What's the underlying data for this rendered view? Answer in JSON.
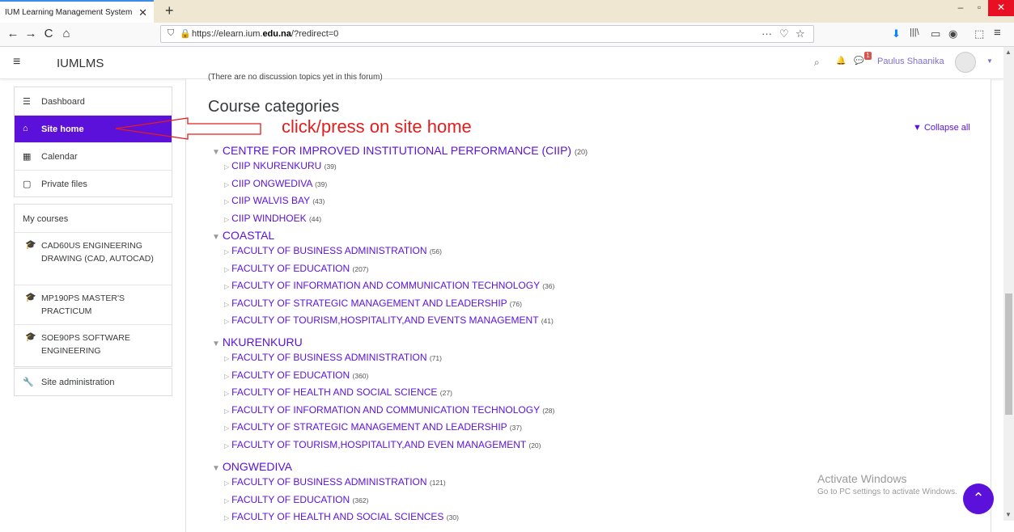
{
  "browser": {
    "tab_title": "IUM Learning Management System",
    "tab_close": "✕",
    "new_tab": "+",
    "url_prefix": "https://elearn.ium.",
    "url_domain": "edu.na",
    "url_suffix": "/?redirect=0",
    "back": "←",
    "forward": "→",
    "reload": "C",
    "home": "⌂",
    "more": "···",
    "pocket": "♡",
    "bookmark": "☆",
    "download": "⬇",
    "library": "|||\\",
    "sidebar": "▭",
    "account": "◉",
    "menu": "≡",
    "extensions": "⬚",
    "win_min": "–",
    "win_max": "▫",
    "win_close": "✕"
  },
  "header": {
    "menu_icon": "≡",
    "site_name": "IUMLMS",
    "search": "⌕",
    "bell": "🔔",
    "messages": "💬",
    "notif_count": "1",
    "user_name": "Paulus Shaanika",
    "caret": "▼"
  },
  "drawer": {
    "nav": [
      {
        "icon": "☰",
        "label": "Dashboard"
      },
      {
        "icon": "⌂",
        "label": "Site home"
      },
      {
        "icon": "▦",
        "label": "Calendar"
      },
      {
        "icon": "▢",
        "label": "Private files"
      }
    ],
    "my_courses_label": "My courses",
    "courses": [
      {
        "icon": "🎓",
        "label": "CAD60US ENGINEERING DRAWING (CAD, AUTOCAD)"
      },
      {
        "icon": "🎓",
        "label": "MP190PS MASTER'S PRACTICUM"
      },
      {
        "icon": "🎓",
        "label": "SOE90PS SOFTWARE ENGINEERING"
      }
    ],
    "admin": {
      "icon": "🔧",
      "label": "Site administration"
    }
  },
  "main": {
    "forum_note": "(There are no discussion topics yet in this forum)",
    "heading": "Course categories",
    "collapse_all": "▼ Collapse all",
    "annotation": "click/press on site home",
    "categories": [
      {
        "name": "CENTRE FOR IMPROVED INSTITUTIONAL PERFORMANCE (CIIP)",
        "count": "(20)",
        "children": [
          {
            "name": "CIIP NKURENKURU",
            "count": "(39)"
          },
          {
            "name": "CIIP ONGWEDIVA",
            "count": "(39)"
          },
          {
            "name": "CIIP WALVIS BAY",
            "count": "(43)"
          },
          {
            "name": "CIIP WINDHOEK",
            "count": "(44)"
          }
        ]
      },
      {
        "name": "COASTAL",
        "count": "",
        "children": [
          {
            "name": "FACULTY OF BUSINESS ADMINISTRATION",
            "count": "(56)"
          },
          {
            "name": "FACULTY OF EDUCATION",
            "count": "(207)"
          },
          {
            "name": "FACULTY OF INFORMATION AND COMMUNICATION TECHNOLOGY",
            "count": "(36)"
          },
          {
            "name": "FACULTY OF STRATEGIC MANAGEMENT AND LEADERSHIP",
            "count": "(76)"
          },
          {
            "name": "FACULTY OF TOURISM,HOSPITALITY,AND EVENTS MANAGEMENT",
            "count": "(41)"
          }
        ]
      },
      {
        "name": "NKURENKURU",
        "count": "",
        "children": [
          {
            "name": "FACULTY OF BUSINESS ADMINISTRATION",
            "count": "(71)"
          },
          {
            "name": "FACULTY OF EDUCATION",
            "count": "(360)"
          },
          {
            "name": "FACULTY OF HEALTH AND SOCIAL SCIENCE",
            "count": "(27)"
          },
          {
            "name": "FACULTY OF INFORMATION AND COMMUNICATION TECHNOLOGY",
            "count": "(28)"
          },
          {
            "name": "FACULTY OF STRATEGIC MANAGEMENT AND LEADERSHIP",
            "count": "(37)"
          },
          {
            "name": "FACULTY OF TOURISM,HOSPITALITY,AND EVEN MANAGEMENT",
            "count": "(20)"
          }
        ]
      },
      {
        "name": "ONGWEDIVA",
        "count": "",
        "children": [
          {
            "name": "FACULTY OF BUSINESS ADMINISTRATION",
            "count": "(121)"
          },
          {
            "name": "FACULTY OF EDUCATION",
            "count": "(362)"
          },
          {
            "name": "FACULTY OF HEALTH AND SOCIAL SCIENCES",
            "count": "(30)"
          }
        ]
      }
    ],
    "caret_open": "▼",
    "caret_closed": "▷"
  },
  "overlay": {
    "activate_title": "Activate Windows",
    "activate_sub": "Go to PC settings to activate Windows.",
    "back_to_top": "⌃"
  },
  "colors": {
    "accent": "#5b11d9",
    "annotation": "#e31e1e"
  }
}
